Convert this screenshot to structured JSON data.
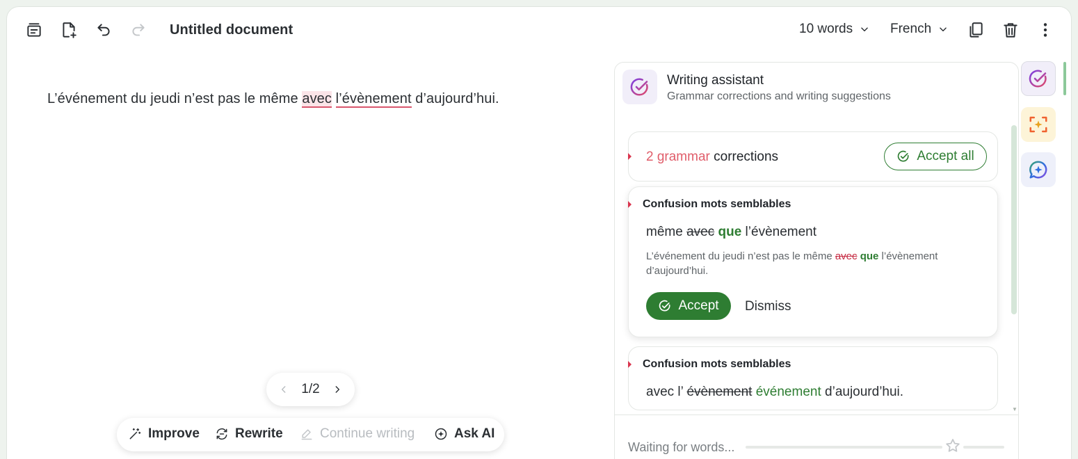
{
  "toolbar": {
    "title": "Untitled document",
    "word_count": "10 words",
    "language": "French"
  },
  "editor": {
    "seg1": "L’événement du jeudi n’est pas le même ",
    "err1": "avec",
    "seg2": " ",
    "err2": "l’évènement",
    "seg3": " d’aujourd’hui."
  },
  "pager": {
    "label": "1/2"
  },
  "ai_bar": {
    "improve": "Improve",
    "rewrite": "Rewrite",
    "continue": "Continue writing",
    "ask": "Ask AI"
  },
  "assistant": {
    "title": "Writing assistant",
    "subtitle": "Grammar corrections and writing suggestions",
    "summary_count": "2 grammar",
    "summary_rest": " corrections",
    "accept_all": "Accept all",
    "cards": [
      {
        "title": "Confusion mots semblables",
        "before": "même ",
        "removed": "avec",
        "added": "que",
        "after": " l’évènement",
        "context_pre": "L’événement du jeudi n’est pas le même ",
        "context_removed": "avec",
        "context_added": "que",
        "context_post": " l’évènement d’aujourd’hui.",
        "accept": "Accept",
        "dismiss": "Dismiss"
      },
      {
        "title": "Confusion mots semblables",
        "before": "avec l’ ",
        "removed": "évènement",
        "added": "événement",
        "after": " d’aujourd’hui."
      }
    ],
    "footer": "Waiting for words..."
  },
  "colors": {
    "accent_green": "#2e7d32",
    "error_red": "#d9566c"
  }
}
